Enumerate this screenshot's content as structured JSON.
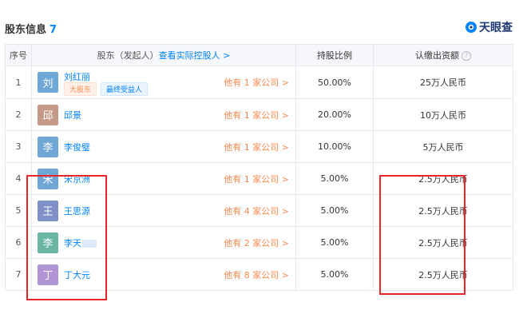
{
  "header": {
    "title": "股东信息",
    "count": "7",
    "logo_text": "天眼查"
  },
  "table": {
    "columns": {
      "index": "序号",
      "name_prefix": "股东（发起人）",
      "name_link": "查看实际控股人 >",
      "ratio": "持股比例",
      "capital": "认缴出资额"
    },
    "rows": [
      {
        "index": "1",
        "avatar_char": "刘",
        "avatar_color": "#6fa7d6",
        "name": "刘红丽",
        "tags": [
          "大股东",
          "最终受益人"
        ],
        "other": "他有 1 家公司 >",
        "ratio": "50.00%",
        "capital": "25万人民币"
      },
      {
        "index": "2",
        "avatar_char": "邱",
        "avatar_color": "#c49a87",
        "name": "邱景",
        "other": "他有 1 家公司 >",
        "ratio": "20.00%",
        "capital": "10万人民币"
      },
      {
        "index": "3",
        "avatar_char": "李",
        "avatar_color": "#6fa7d6",
        "name": "李俊璧",
        "other": "他有 1 家公司 >",
        "ratio": "10.00%",
        "capital": "5万人民币"
      },
      {
        "index": "4",
        "avatar_char": "宋",
        "avatar_color": "#6fa7d6",
        "name": "宋京洲",
        "other": "他有 1 家公司 >",
        "ratio": "5.00%",
        "capital": "2.5万人民币"
      },
      {
        "index": "5",
        "avatar_char": "王",
        "avatar_color": "#7d91c8",
        "name": "王思源",
        "other": "他有 4 家公司 >",
        "ratio": "5.00%",
        "capital": "2.5万人民币"
      },
      {
        "index": "6",
        "avatar_char": "李",
        "avatar_color": "#69b6a1",
        "name": "李天",
        "other": "他有 2 家公司 >",
        "ratio": "5.00%",
        "capital": "2.5万人民币"
      },
      {
        "index": "7",
        "avatar_char": "丁",
        "avatar_color": "#b194d6",
        "name": "丁大元",
        "other": "他有 8 家公司 >",
        "ratio": "5.00%",
        "capital": "2.5万人民币"
      }
    ]
  },
  "colors": {
    "link": "#0084ff",
    "orange": "#fe8a4f",
    "highlight_box": "#e5252a"
  }
}
